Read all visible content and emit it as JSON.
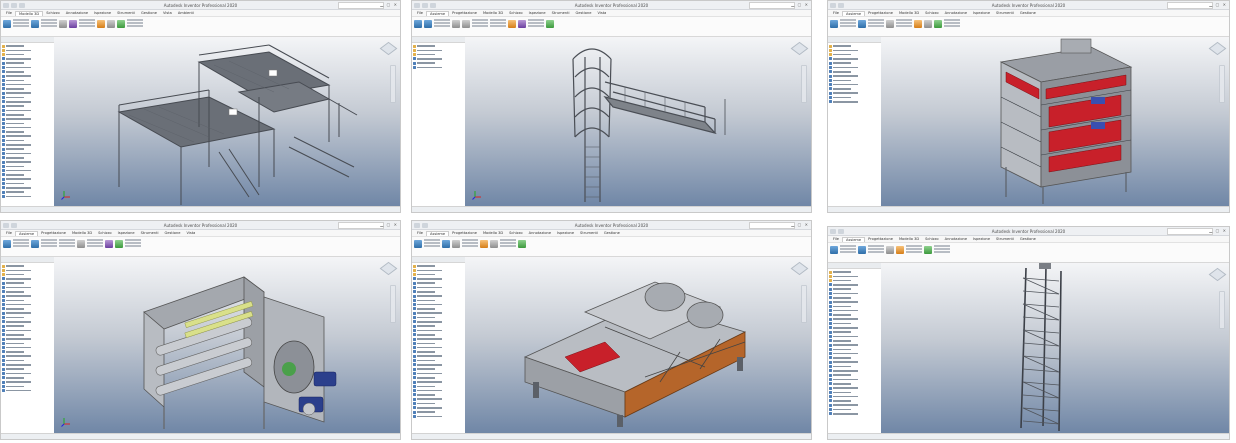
{
  "screens": [
    {
      "title": "Autodesk Inventor Professional 2020",
      "tabs": [
        "File",
        "Modello 3D",
        "Schizzo",
        "Annotazione",
        "Ispezione",
        "Strumenti",
        "Gestione",
        "Vista",
        "Ambienti"
      ]
    },
    {
      "title": "Autodesk Inventor Professional 2020",
      "tabs": [
        "File",
        "Assieme",
        "Progettazione",
        "Modello 3D",
        "Schizzo",
        "Ispezione",
        "Strumenti",
        "Gestione",
        "Vista"
      ]
    },
    {
      "title": "Autodesk Inventor Professional 2020",
      "tabs": [
        "File",
        "Assieme",
        "Progettazione",
        "Modello 3D",
        "Schizzo",
        "Annotazione",
        "Ispezione",
        "Strumenti",
        "Gestione"
      ]
    },
    {
      "title": "Autodesk Inventor Professional 2020",
      "tabs": [
        "File",
        "Assieme",
        "Progettazione",
        "Modello 3D",
        "Schizzo",
        "Ispezione",
        "Strumenti",
        "Gestione",
        "Vista"
      ]
    },
    {
      "title": "Autodesk Inventor Professional 2020",
      "tabs": [
        "File",
        "Assieme",
        "Progettazione",
        "Modello 3D",
        "Schizzo",
        "Annotazione",
        "Ispezione",
        "Strumenti",
        "Gestione"
      ]
    },
    {
      "title": "Autodesk Inventor Professional 2020",
      "tabs": [
        "File",
        "Assieme",
        "Progettazione",
        "Modello 3D",
        "Schizzo",
        "Annotazione",
        "Ispezione",
        "Strumenti",
        "Gestione"
      ]
    }
  ],
  "icons": {
    "viewcube": "viewcube-icon",
    "navbar": "navigation-bar-icon",
    "triad": "axis-triad-icon"
  },
  "colors": {
    "viewport_top": "#f4f5f7",
    "viewport_bottom": "#6f86a6",
    "model_steel": "#8c9097",
    "model_red": "#c8202a",
    "model_orange": "#b5652a",
    "model_blue": "#2b3f8c",
    "model_green": "#3a9a3a"
  }
}
